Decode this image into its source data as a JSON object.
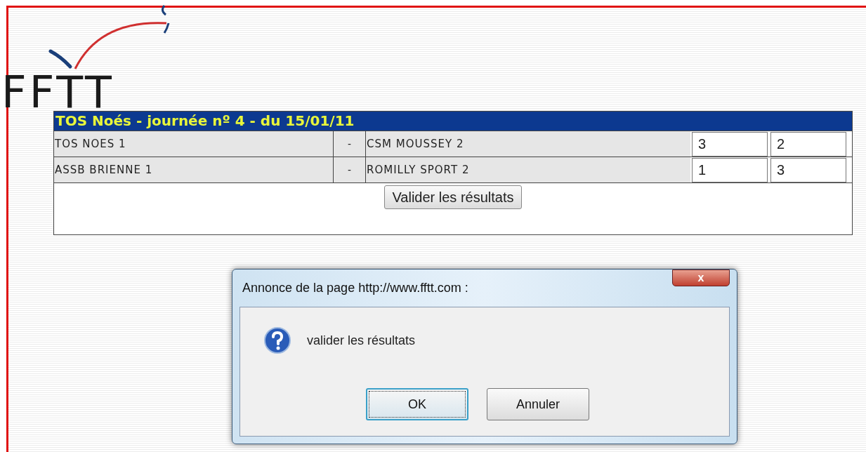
{
  "logo": {
    "text": "FFTT"
  },
  "results_table": {
    "title": "TOS Noés - journée nº 4 - du 15/01/11",
    "rows": [
      {
        "home": "TOS NOES 1",
        "separator": "-",
        "away": "CSM MOUSSEY 2",
        "home_score": "3",
        "away_score": "2"
      },
      {
        "home": "ASSB BRIENNE 1",
        "separator": "-",
        "away": "ROMILLY SPORT 2",
        "home_score": "1",
        "away_score": "3"
      }
    ],
    "submit_button": "Valider les résultats"
  },
  "dialog": {
    "title": "Annonce de la page http://www.fftt.com :",
    "close": "x",
    "message": "valider les résultats",
    "buttons": [
      {
        "label": "OK",
        "focused": true
      },
      {
        "label": "Annuler",
        "focused": false
      }
    ]
  }
}
